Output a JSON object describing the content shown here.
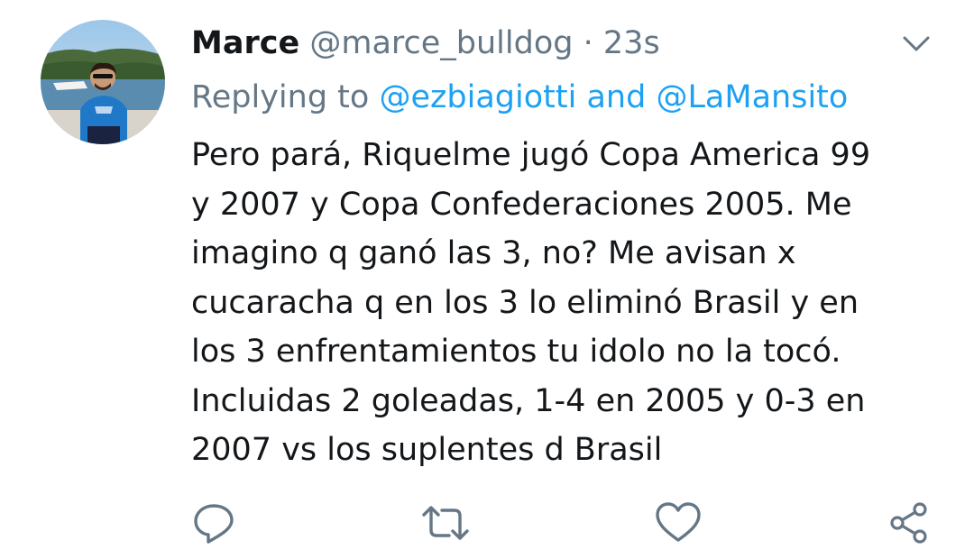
{
  "tweet": {
    "name": "Marce",
    "handle": "@marce_bulldog",
    "separator": "·",
    "time": "23s",
    "replying_prefix": "Replying to",
    "reply_mention_1": "@ezbiagiotti",
    "reply_conjunction": "and",
    "reply_mention_2": "@LaMansito",
    "text_lines": [
      "Pero pará, Riquelme jugó Copa America 99",
      "y 2007 y Copa Confederaciones 2005. Me",
      "imagino q ganó las 3, no? Me avisan x",
      "cucaracha q en los 3 lo eliminó Brasil y en",
      "los 3 enfrentamientos tu idolo no la tocó.",
      "Incluidas 2 goleadas, 1-4 en 2005 y 0-3 en",
      "2007 vs los suplentes d Brasil"
    ]
  },
  "icons": {
    "menu": "chevron-down-icon",
    "reply": "reply-icon",
    "retweet": "retweet-icon",
    "like": "heart-icon",
    "share": "share-icon"
  },
  "colors": {
    "text": "#14171a",
    "secondary": "#657786",
    "link": "#1da1f2"
  }
}
